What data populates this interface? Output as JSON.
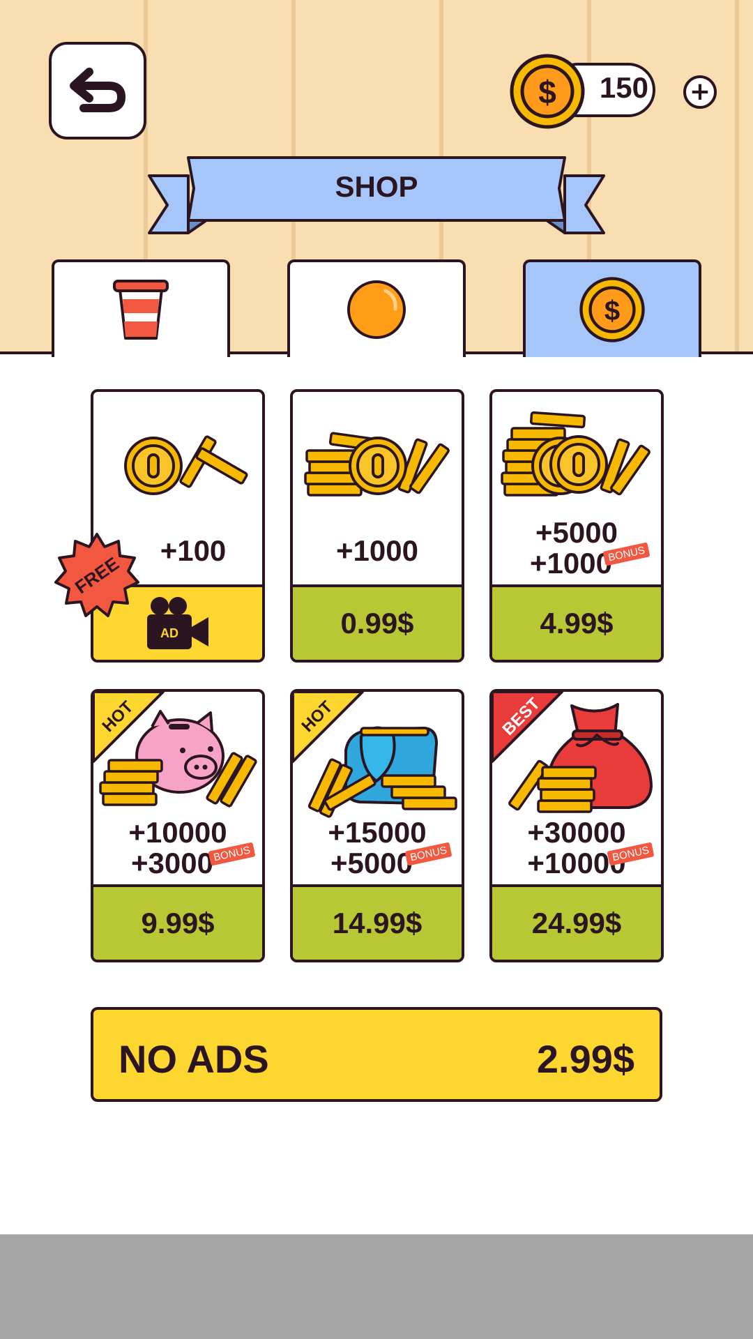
{
  "header": {
    "coin_count": "150",
    "plus_label": "+",
    "coin_symbol": "$"
  },
  "banner": {
    "title": "SHOP"
  },
  "tabs": [
    {
      "name": "cups",
      "icon": "cup-icon",
      "active": false
    },
    {
      "name": "balls",
      "icon": "ball-icon",
      "active": false
    },
    {
      "name": "coins",
      "icon": "coin-icon",
      "active": true
    }
  ],
  "products": [
    {
      "amount": "+100",
      "bonus": "",
      "bonus_tag": "",
      "price": "",
      "badge": "FREE",
      "ad_label": "AD",
      "ribbon": ""
    },
    {
      "amount": "+1000",
      "bonus": "",
      "bonus_tag": "",
      "price": "0.99$",
      "badge": "",
      "ribbon": ""
    },
    {
      "amount": "+5000",
      "bonus": "+1000",
      "bonus_tag": "BONUS",
      "price": "4.99$",
      "badge": "",
      "ribbon": ""
    },
    {
      "amount": "+10000",
      "bonus": "+3000",
      "bonus_tag": "BONUS",
      "price": "9.99$",
      "ribbon": "HOT"
    },
    {
      "amount": "+15000",
      "bonus": "+5000",
      "bonus_tag": "BONUS",
      "price": "14.99$",
      "ribbon": "HOT"
    },
    {
      "amount": "+30000",
      "bonus": "+10000",
      "bonus_tag": "BONUS",
      "price": "24.99$",
      "ribbon": "BEST"
    }
  ],
  "no_ads": {
    "label": "NO ADS",
    "price": "2.99$"
  },
  "colors": {
    "wallpaper": "#f8deb0",
    "stripe": "#ecc997",
    "outline": "#2a1520",
    "tab_active": "#a6c6f9",
    "price_green": "#b8c835",
    "yellow": "#fdd62f",
    "coin_gold": "#f7b900",
    "bonus_red": "#f2573f",
    "bottom_bar": "#a5a5a5"
  }
}
